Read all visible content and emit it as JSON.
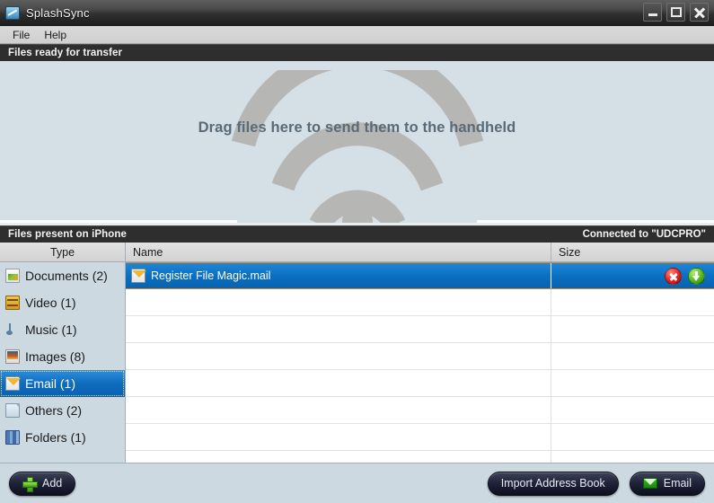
{
  "window": {
    "title": "SplashSync",
    "icon": "app-icon",
    "controls": {
      "minimize": "minimize",
      "maximize": "maximize",
      "close": "close"
    }
  },
  "menu": {
    "items": [
      {
        "label": "File"
      },
      {
        "label": "Help"
      }
    ]
  },
  "transfer_section": {
    "header": "Files ready for transfer",
    "dropzone_text": "Drag files here to send them to the handheld",
    "dropzone_icon": "wifi-icon",
    "dropzone_bg": "#d5dfe6",
    "wifi_color": "#b6b6b4"
  },
  "device_section": {
    "header": "Files present on iPhone",
    "connection_status": "Connected to \"UDCPRO\""
  },
  "sidebar": {
    "column_header": "Type",
    "items": [
      {
        "label": "Documents (2)",
        "icon": "document-icon",
        "selected": false
      },
      {
        "label": "Video (1)",
        "icon": "video-icon",
        "selected": false
      },
      {
        "label": "Music (1)",
        "icon": "music-icon",
        "selected": false
      },
      {
        "label": "Images (8)",
        "icon": "image-icon",
        "selected": false
      },
      {
        "label": "Email (1)",
        "icon": "mail-icon",
        "selected": true
      },
      {
        "label": "Others (2)",
        "icon": "page-icon",
        "selected": false
      },
      {
        "label": "Folders (1)",
        "icon": "folder-icon",
        "selected": false
      }
    ]
  },
  "filelist": {
    "columns": [
      {
        "key": "name",
        "label": "Name"
      },
      {
        "key": "size",
        "label": "Size"
      }
    ],
    "rows": [
      {
        "name": "Register File Magic.mail",
        "size": "",
        "icon": "mail-icon",
        "selected": true,
        "actions": [
          {
            "name": "delete-file-button",
            "icon": "red-x-icon"
          },
          {
            "name": "download-file-button",
            "icon": "green-down-arrow-icon"
          }
        ]
      }
    ],
    "empty_row_count": 7,
    "selection_color": "#0a6ec0",
    "selection_border": "#d88a2a"
  },
  "bottombar": {
    "add_button": {
      "label": "Add",
      "icon": "plus-icon"
    },
    "import_button": {
      "label": "Import Address Book"
    },
    "email_button": {
      "label": "Email",
      "icon": "envelope-icon"
    }
  }
}
